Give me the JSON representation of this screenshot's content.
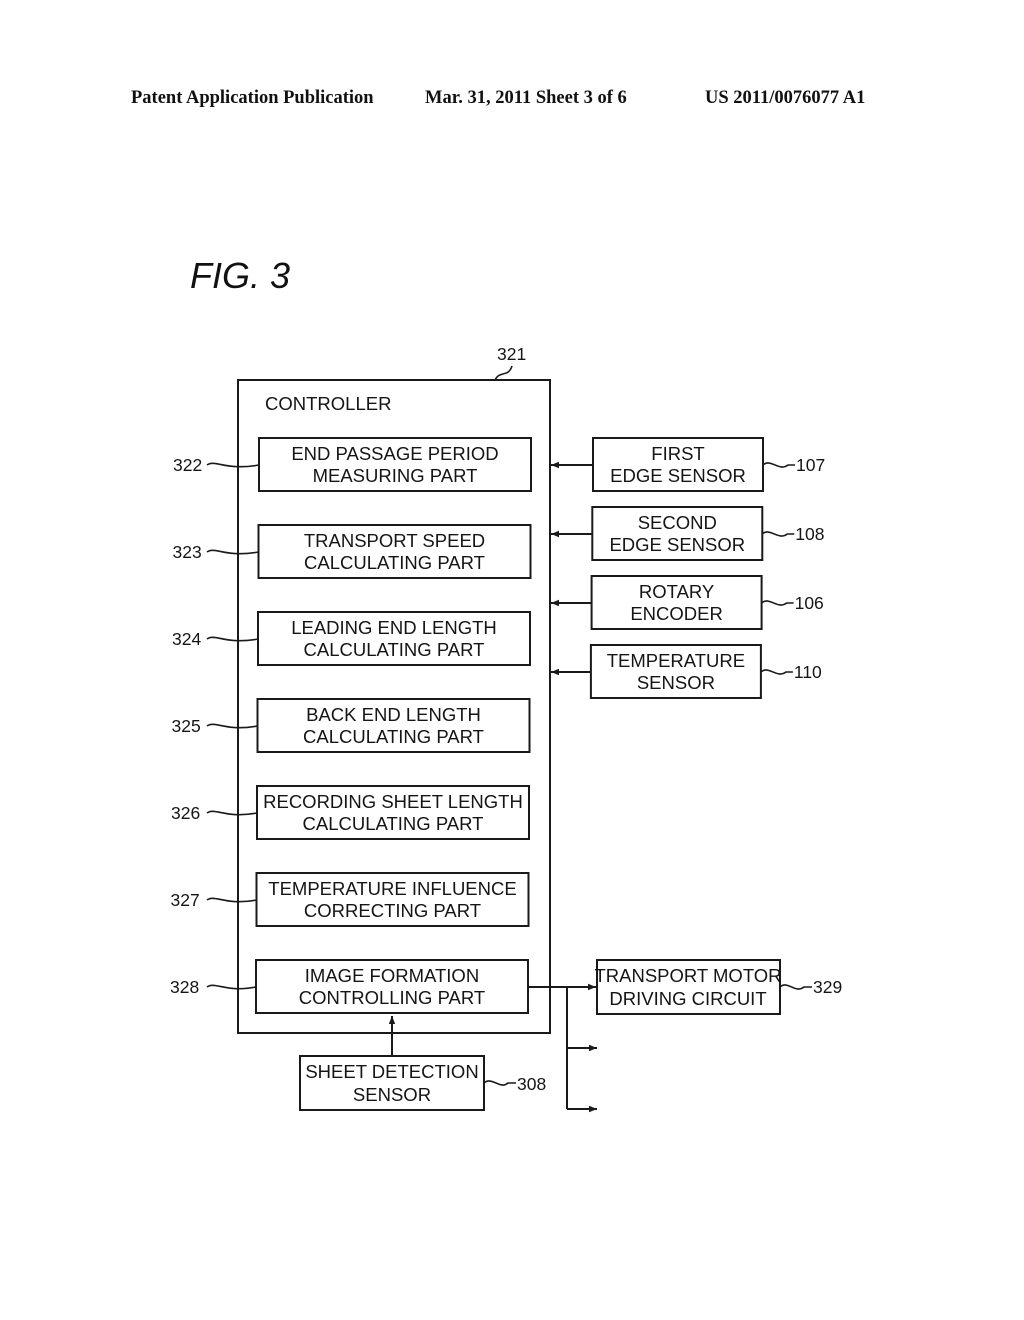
{
  "header": {
    "publication": "Patent Application Publication",
    "date_sheet": "Mar. 31, 2011  Sheet 3 of 6",
    "number": "US 2011/0076077 A1"
  },
  "figure": {
    "title": "FIG. 3",
    "controller": {
      "ref": "321",
      "label": "CONTROLLER",
      "parts": [
        {
          "ref": "322",
          "lines": [
            "END PASSAGE PERIOD",
            "MEASURING PART"
          ]
        },
        {
          "ref": "323",
          "lines": [
            "TRANSPORT SPEED",
            "CALCULATING PART"
          ]
        },
        {
          "ref": "324",
          "lines": [
            "LEADING END LENGTH",
            "CALCULATING PART"
          ]
        },
        {
          "ref": "325",
          "lines": [
            "BACK END LENGTH",
            "CALCULATING PART"
          ]
        },
        {
          "ref": "326",
          "lines": [
            "RECORDING SHEET LENGTH",
            "CALCULATING PART"
          ]
        },
        {
          "ref": "327",
          "lines": [
            "TEMPERATURE INFLUENCE",
            "CORRECTING PART"
          ]
        },
        {
          "ref": "328",
          "lines": [
            "IMAGE FORMATION",
            "CONTROLLING PART"
          ]
        }
      ]
    },
    "inputs": [
      {
        "ref": "107",
        "lines": [
          "FIRST",
          "EDGE SENSOR"
        ]
      },
      {
        "ref": "108",
        "lines": [
          "SECOND",
          "EDGE SENSOR"
        ]
      },
      {
        "ref": "106",
        "lines": [
          "ROTARY",
          "ENCODER"
        ]
      },
      {
        "ref": "110",
        "lines": [
          "TEMPERATURE",
          "SENSOR"
        ]
      }
    ],
    "output": {
      "ref": "329",
      "lines": [
        "TRANSPORT MOTOR",
        "DRIVING CIRCUIT"
      ]
    },
    "sheet_sensor": {
      "ref": "308",
      "lines": [
        "SHEET DETECTION",
        "SENSOR"
      ]
    }
  }
}
